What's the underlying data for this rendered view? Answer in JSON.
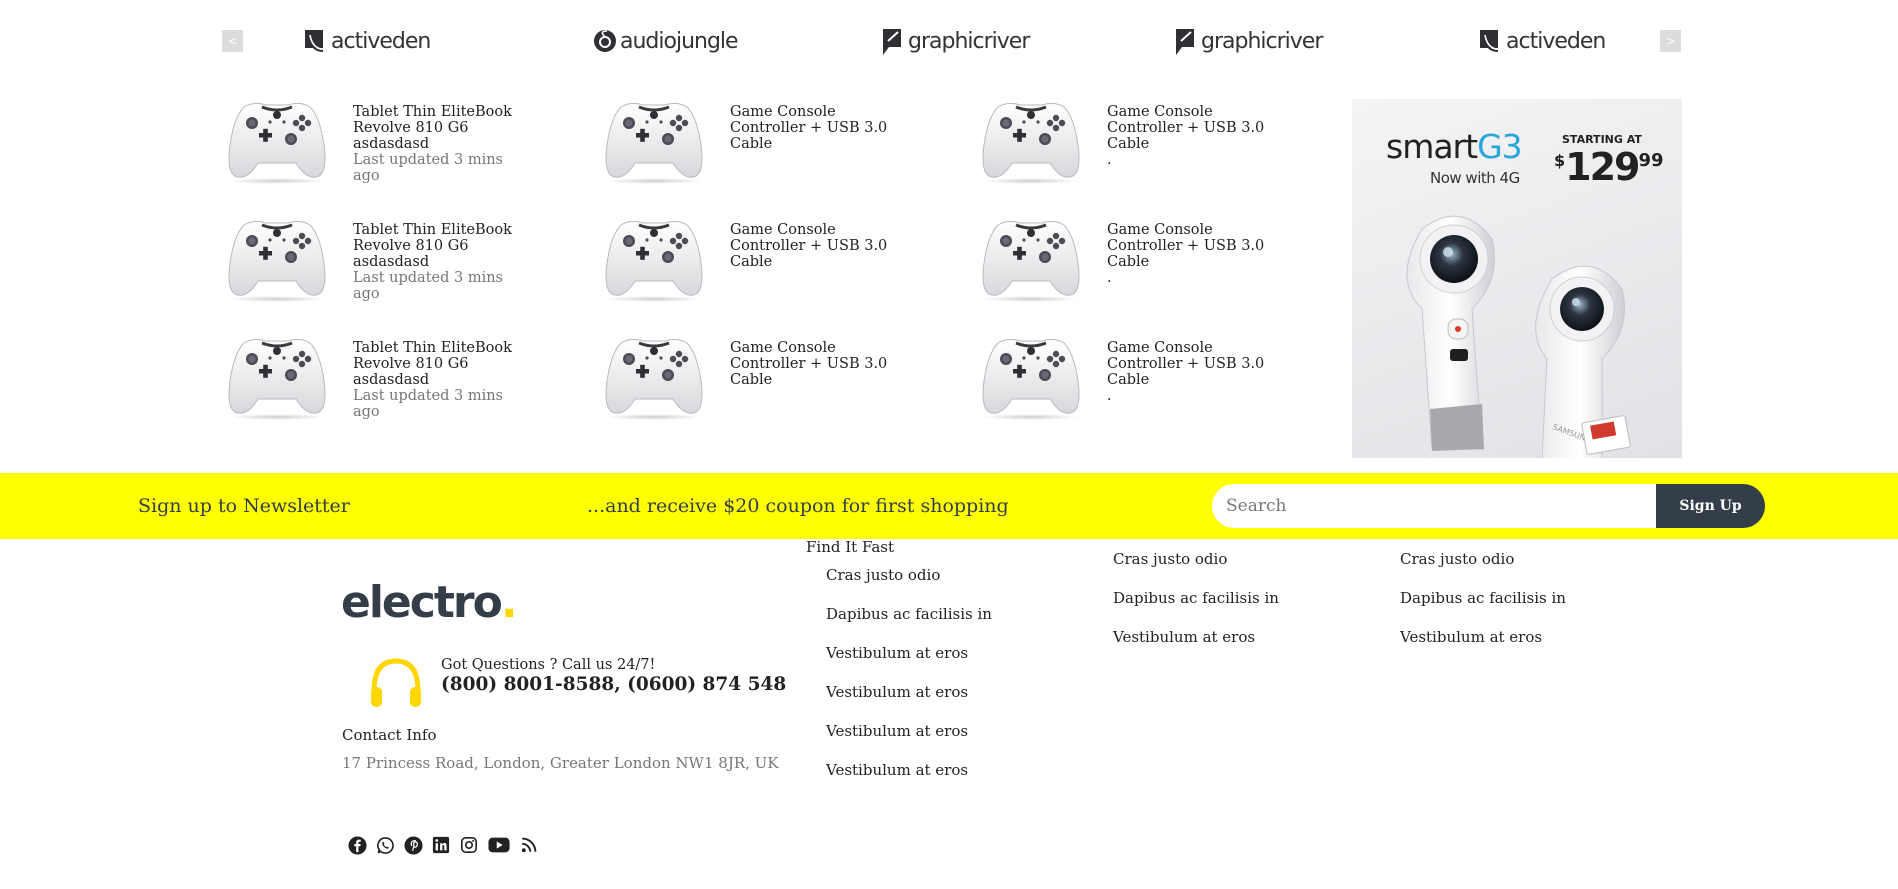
{
  "brands": {
    "prev_label": "<",
    "next_label": ">",
    "items": [
      {
        "name": "activeden",
        "icon": "activeden-icon"
      },
      {
        "name": "audiojungle",
        "icon": "audiojungle-icon"
      },
      {
        "name": "graphicriver",
        "icon": "graphicriver-icon"
      },
      {
        "name": "graphicriver",
        "icon": "graphicriver-icon"
      },
      {
        "name": "activeden",
        "icon": "activeden-icon"
      }
    ]
  },
  "products": {
    "col1": [
      {
        "title": "Tablet Thin EliteBook Revolve 810 G6",
        "extra": "asdasdasd",
        "updated": "Last updated 3 mins ago"
      },
      {
        "title": "Tablet Thin EliteBook Revolve 810 G6",
        "extra": "asdasdasd",
        "updated": "Last updated 3 mins ago"
      },
      {
        "title": "Tablet Thin EliteBook Revolve 810 G6",
        "extra": "asdasdasd",
        "updated": "Last updated 3 mins ago"
      }
    ],
    "col2": [
      {
        "title": "Game Console Controller + USB 3.0 Cable"
      },
      {
        "title": "Game Console Controller + USB 3.0 Cable"
      },
      {
        "title": "Game Console Controller + USB 3.0 Cable"
      }
    ],
    "col3": [
      {
        "title": "Game Console Controller + USB 3.0 Cable",
        "extra": "."
      },
      {
        "title": "Game Console Controller + USB 3.0 Cable",
        "extra": "."
      },
      {
        "title": "Game Console Controller + USB 3.0 Cable",
        "extra": "."
      }
    ]
  },
  "ad": {
    "brand_smart": "smart",
    "brand_g3": "G3",
    "subtitle": "Now with 4G",
    "starting": "STARTING AT",
    "currency": "$",
    "price_whole": "129",
    "price_cents": "99",
    "camera_brand": "SAMSUNG"
  },
  "newsletter": {
    "title": "Sign up to Newsletter",
    "coupon": "...and receive $20 coupon for first shopping",
    "placeholder": "Search",
    "button": "Sign Up"
  },
  "footer": {
    "logo_text": "electro",
    "logo_dot": ".",
    "support_question": "Got Questions ? Call us 24/7!",
    "support_phone": "(800) 8001-8588, (0600) 874 548",
    "contact_label": "Contact Info",
    "contact_address": "17 Princess Road, London, Greater London NW1 8JR, UK",
    "social_icons": [
      "facebook-icon",
      "whatsapp-icon",
      "pinterest-icon",
      "linkedin-icon",
      "instagram-icon",
      "youtube-icon",
      "rss-icon"
    ],
    "find_it_fast": {
      "title": "Find It Fast",
      "links": [
        "Cras justo odio",
        "Dapibus ac facilisis in",
        "Vestibulum at eros",
        "Vestibulum at eros",
        "Vestibulum at eros",
        "Vestibulum at eros"
      ]
    },
    "col2_links": [
      "Cras justo odio",
      "Dapibus ac facilisis in",
      "Vestibulum at eros"
    ],
    "col3_links": [
      "Cras justo odio",
      "Dapibus ac facilisis in",
      "Vestibulum at eros"
    ]
  },
  "colors": {
    "newsletter_bg": "#ffff00",
    "primary_dark": "#333e48",
    "accent_yellow": "#fed700",
    "accent_blue": "#2aa6dc"
  }
}
